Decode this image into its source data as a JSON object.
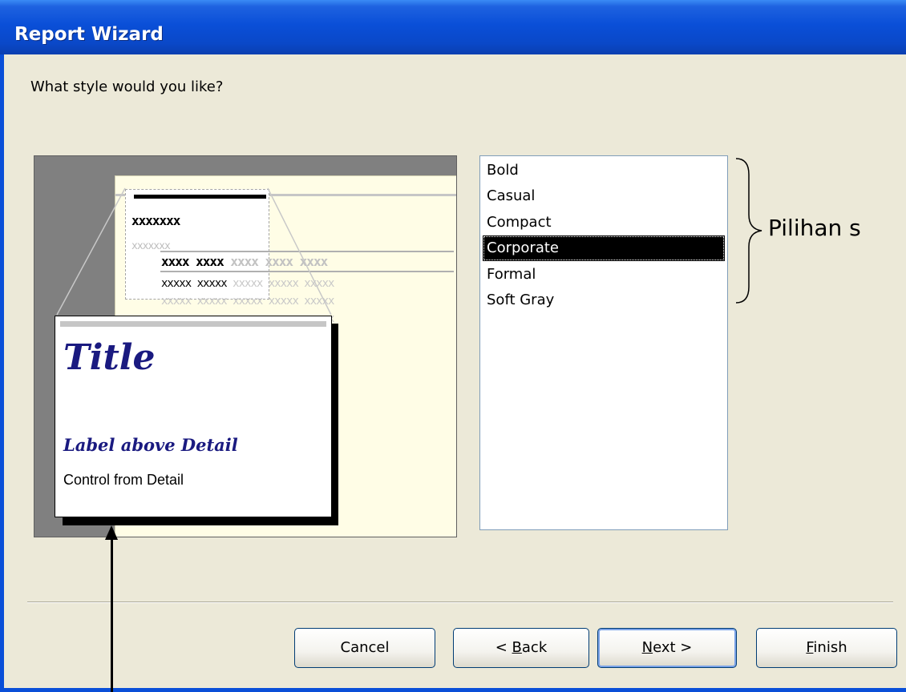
{
  "window": {
    "title": "Report Wizard"
  },
  "prompt": "What style would you like?",
  "preview": {
    "header_text": "xxxxxxx",
    "subheader_text": "xxxxxxx",
    "column_header_dark": "xxxx xxxx",
    "column_header_light": "xxxx xxxx xxxx",
    "row_dark": "xxxxx xxxxx",
    "row_light": "xxxxx xxxxx xxxxx",
    "callout": {
      "title": "Title",
      "label": "Label above Detail",
      "control": "Control from Detail"
    }
  },
  "styles": {
    "items": [
      "Bold",
      "Casual",
      "Compact",
      "Corporate",
      "Formal",
      "Soft Gray"
    ],
    "selected": "Corporate"
  },
  "annotation": "Pilihan s",
  "buttons": {
    "cancel": "Cancel",
    "back_prefix": "< ",
    "back_key": "B",
    "back_rest": "ack",
    "next_key": "N",
    "next_rest": "ext >",
    "finish_key": "F",
    "finish_rest": "inish"
  },
  "colors": {
    "titlebar": "#0a4fd8",
    "dialog_bg": "#ece9d8",
    "preview_bg": "#808080",
    "paper": "#fffde6",
    "callout_text": "#1a1a80",
    "selection": "#000000"
  }
}
